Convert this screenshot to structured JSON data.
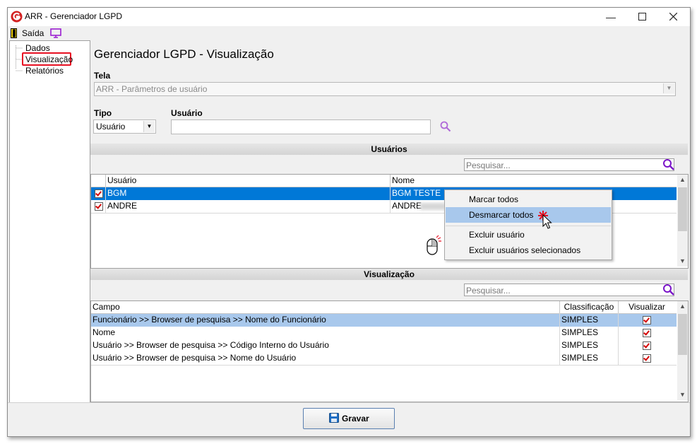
{
  "window": {
    "title": "ARR - Gerenciador LGPD"
  },
  "menu": {
    "exit_label": "Saída"
  },
  "sidebar": {
    "items": [
      {
        "label": "Dados"
      },
      {
        "label": "Visualização"
      },
      {
        "label": "Relatórios"
      }
    ]
  },
  "page": {
    "title": "Gerenciador LGPD - Visualização"
  },
  "tela": {
    "label": "Tela",
    "value": "ARR - Parâmetros de usuário"
  },
  "tipo": {
    "label": "Tipo",
    "value": "Usuário"
  },
  "usuario_filter": {
    "label": "Usuário",
    "value": ""
  },
  "usuarios_section": {
    "title": "Usuários",
    "search_placeholder": "Pesquisar...",
    "columns": [
      "Usuário",
      "Nome"
    ],
    "rows": [
      {
        "usuario": "BGM",
        "nome": "BGM TESTE",
        "checked": true
      },
      {
        "usuario": "ANDRE",
        "nome": "ANDRE",
        "checked": true
      }
    ]
  },
  "context_menu": {
    "items": [
      "Marcar todos",
      "Desmarcar todos",
      "Excluir usuário",
      "Excluir usuários selecionados"
    ]
  },
  "visualizacao_section": {
    "title": "Visualização",
    "search_placeholder": "Pesquisar...",
    "columns": [
      "Campo",
      "Classificação",
      "Visualizar"
    ],
    "rows": [
      {
        "campo": "Funcionário >> Browser de pesquisa >> Nome do Funcionário",
        "classificacao": "SIMPLES",
        "visualizar": true
      },
      {
        "campo": "Nome",
        "classificacao": "SIMPLES",
        "visualizar": true
      },
      {
        "campo": "Usuário >> Browser de pesquisa >> Código Interno do Usuário",
        "classificacao": "SIMPLES",
        "visualizar": true
      },
      {
        "campo": "Usuário >> Browser de pesquisa >> Nome do Usuário",
        "classificacao": "SIMPLES",
        "visualizar": true
      }
    ]
  },
  "footer": {
    "save_label": "Gravar"
  },
  "colors": {
    "accent": "#0078d7",
    "selection": "#a8c8ec",
    "highlight_box": "#e81123",
    "icon_purple": "#8a2be2"
  }
}
